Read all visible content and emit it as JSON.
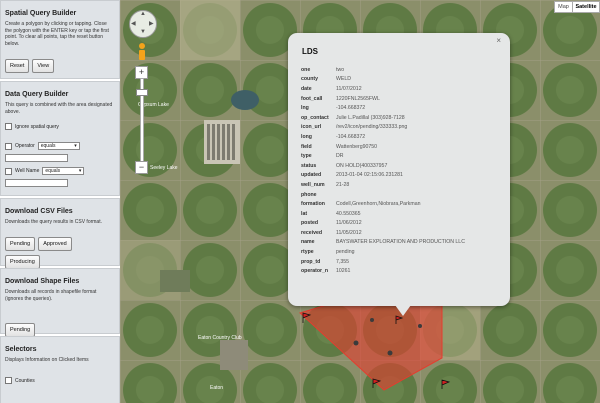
{
  "sidebar": {
    "spatial": {
      "title": "Spatial Query Builder",
      "desc": "Create a polygon by clicking or tapping. Close the polygon with the ENTER key or tap the first point. To clear all points, tap the reset button below.",
      "reset_label": "Reset",
      "view_label": "View"
    },
    "data": {
      "title": "Data Query Builder",
      "desc": "This query is combined with the area designated above.",
      "ignore_label": "Ignore spatial query",
      "operator_label": "Operator",
      "operator_value": "equals",
      "wellname_label": "Well Name",
      "wellname_value": "equals"
    },
    "csv": {
      "title": "Download CSV Files",
      "desc": "Downloads the query results in CSV format.",
      "pending_label": "Pending",
      "approved_label": "Approved",
      "producing_label": "Producing"
    },
    "shape": {
      "title": "Download Shape Files",
      "desc": "Downloads all records in shapefile format (ignores the queries).",
      "pending_label": "Pending"
    },
    "selectors": {
      "title": "Selectors",
      "desc": "Displays Information on Clicked Items",
      "counties_label": "Counties"
    }
  },
  "map": {
    "map_button": "Map",
    "satellite_button": "Satellite",
    "place_labels": [
      "Gypsum Lake",
      "Seeley Lake",
      "Eaton Country Club",
      "Eaton"
    ]
  },
  "popup": {
    "title": "LDS",
    "close_glyph": "×",
    "rows": [
      {
        "k": "one",
        "v": "two"
      },
      {
        "k": "county",
        "v": "WELD"
      },
      {
        "k": "date",
        "v": "11/07/2012"
      },
      {
        "k": "foot_call",
        "v": "1220FNL2565FWL"
      },
      {
        "k": "lng",
        "v": "-104.668372"
      },
      {
        "k": "op_contact",
        "v": "Julie L.Padillal (303)928-7128"
      },
      {
        "k": "icon_url",
        "v": "/rev2/icon/pending/333333.png"
      },
      {
        "k": "long",
        "v": "-104.668372"
      },
      {
        "k": "field",
        "v": "Wattenberg90750"
      },
      {
        "k": "type",
        "v": "DR"
      },
      {
        "k": "status",
        "v": "ON HOLD(400337957"
      },
      {
        "k": "updated",
        "v": "2013-01-04 02:15:06.231281"
      },
      {
        "k": "well_num",
        "v": "21-28"
      },
      {
        "k": "phone",
        "v": ""
      },
      {
        "k": "formation",
        "v": "Codell,Greenhorn,Niobrara,Parkman"
      },
      {
        "k": "lat",
        "v": "40.550365"
      },
      {
        "k": "posted",
        "v": "11/06/2012"
      },
      {
        "k": "received",
        "v": "11/05/2012"
      },
      {
        "k": "name",
        "v": "BAYSWATER EXPLORATION AND PRODUCTION LLC"
      },
      {
        "k": "rtype",
        "v": "pending"
      },
      {
        "k": "prop_td",
        "v": "7,355"
      },
      {
        "k": "operator_n",
        "v": "10261"
      }
    ]
  },
  "colors": {
    "panel_bg": "#dfe3e7",
    "selection_fill": "#e53c2e",
    "popup_bg": "#e5e7e7"
  }
}
